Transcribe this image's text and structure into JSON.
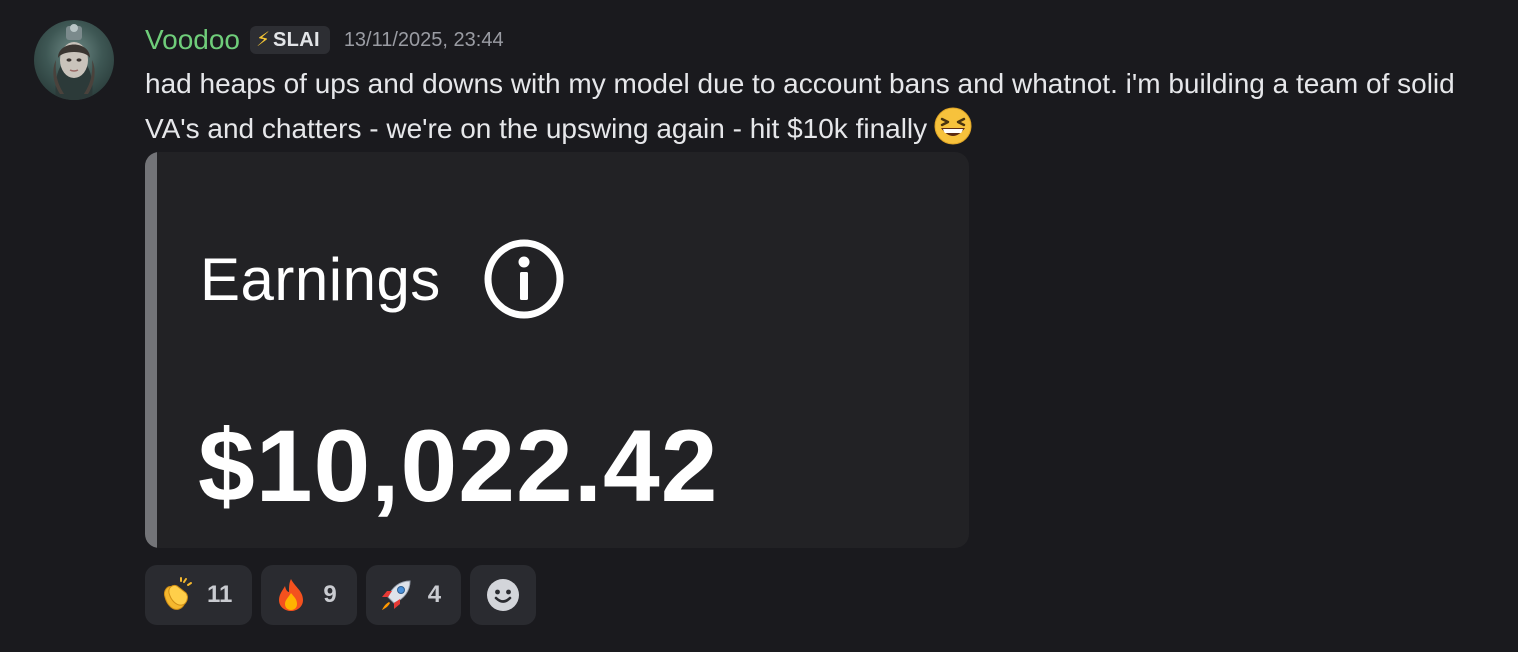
{
  "message": {
    "username": "Voodoo",
    "username_color": "#6fcd7a",
    "role_tag": {
      "icon": "lightning-bolt-icon",
      "glyph": "⚡",
      "label": "SLAI"
    },
    "timestamp": "13/11/2025, 23:44",
    "text": "had heaps of ups and downs with my model due to account bans and whatnot. i'm building a team of solid VA's and chatters - we're on the upswing again - hit $10k finally",
    "trailing_emoji": "laughing-face-emoji"
  },
  "embed": {
    "title": "Earnings",
    "info_icon": "info-circle-icon",
    "amount": "$10,022.42",
    "accent_color": "#737478"
  },
  "reactions": [
    {
      "emoji": "clapping-hands-emoji",
      "glyph": "👏",
      "count": "11"
    },
    {
      "emoji": "fire-emoji",
      "glyph": "🔥",
      "count": "9"
    },
    {
      "emoji": "rocket-emoji",
      "glyph": "🚀",
      "count": "4"
    }
  ],
  "add_reaction_icon": "add-reaction-smiley-icon"
}
